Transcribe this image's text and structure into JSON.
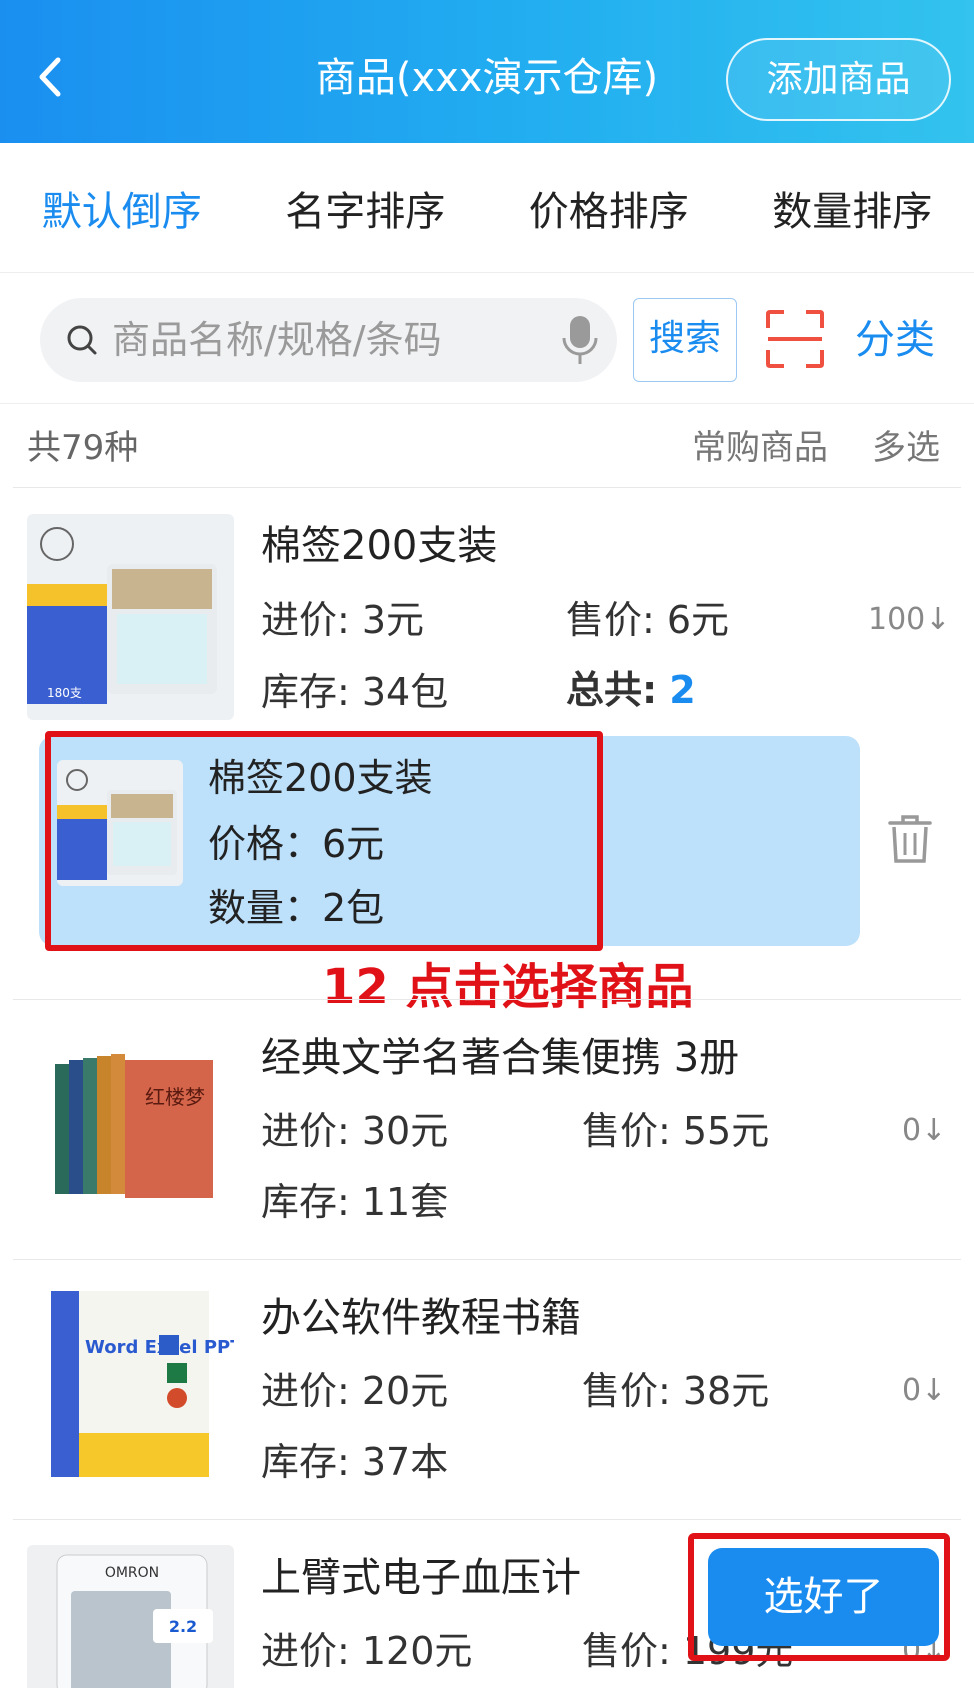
{
  "header": {
    "title": "商品(xxx演示仓库)",
    "add_label": "添加商品"
  },
  "sort_tabs": [
    {
      "label": "默认倒序",
      "active": true
    },
    {
      "label": "名字排序",
      "active": false
    },
    {
      "label": "价格排序",
      "active": false
    },
    {
      "label": "数量排序",
      "active": false
    }
  ],
  "search": {
    "placeholder": "商品名称/规格/条码",
    "button_label": "搜索",
    "category_label": "分类"
  },
  "list_header": {
    "count": "共79种",
    "frequent": "常购商品",
    "multi_select": "多选"
  },
  "products": [
    {
      "name": "棉签200支装",
      "cost": "进价: 3元",
      "price": "售价: 6元",
      "stock": "库存: 34包",
      "total_label": "总共:",
      "total_value": "2",
      "qty": "100↓",
      "thumb_text": "180支"
    },
    {
      "name": "经典文学名著合集便携  3册",
      "cost": "进价: 30元",
      "price": "售价: 55元",
      "stock": "库存: 11套",
      "qty": "0↓",
      "thumb_text": "红楼梦"
    },
    {
      "name": "办公软件教程书籍",
      "cost": "进价: 20元",
      "price": "售价: 38元",
      "stock": "库存: 37本",
      "qty": "0↓",
      "thumb_text": "Word Excel PPT"
    },
    {
      "name": "上臂式电子血压计",
      "cost": "进价: 120元",
      "price": "售价: 199元",
      "qty": "0↓",
      "thumb_text": "OMRON"
    }
  ],
  "selected": {
    "name": "棉签200支装",
    "price": "价格：6元",
    "qty": "数量：2包"
  },
  "annotation": "12 点击选择商品",
  "done_label": "选好了",
  "colors": {
    "accent": "#1a8cf0",
    "highlight": "#e01218",
    "selected_bg": "#bde0fb"
  }
}
